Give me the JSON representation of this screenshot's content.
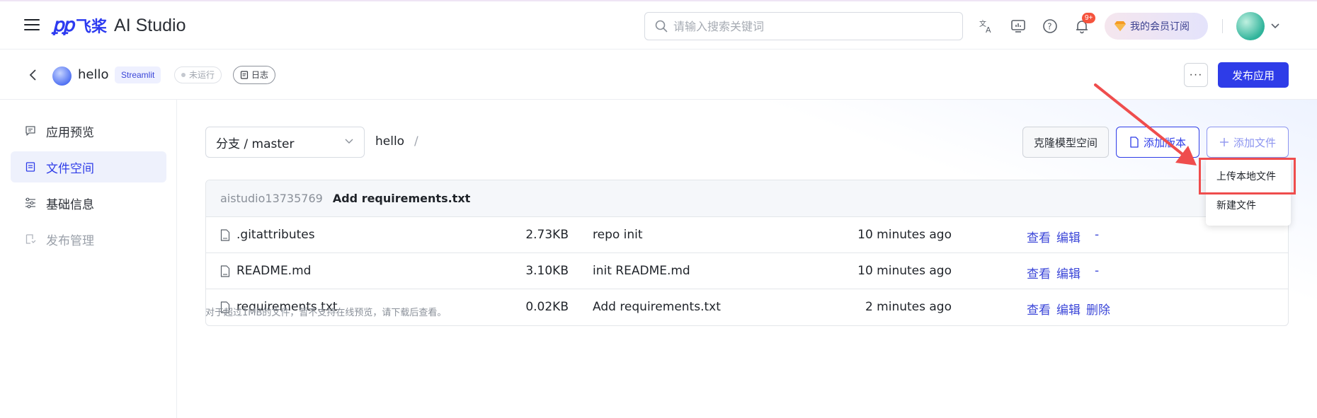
{
  "header": {
    "logo_mark": "ꝑꝑ",
    "logo_cn": "飞桨",
    "logo_en": "AI Studio",
    "search_placeholder": "请输入搜索关键词",
    "notification_badge": "9+",
    "vip_label": "我的会员订阅"
  },
  "project": {
    "name": "hello",
    "framework_tag": "Streamlit",
    "status": "未运行",
    "log_label": "日志",
    "more_label": "···",
    "publish_label": "发布应用"
  },
  "sidebar": {
    "items": [
      {
        "label": "应用预览",
        "icon": "comment-icon",
        "state": "normal"
      },
      {
        "label": "文件空间",
        "icon": "file-icon",
        "state": "active"
      },
      {
        "label": "基础信息",
        "icon": "sliders-icon",
        "state": "normal"
      },
      {
        "label": "发布管理",
        "icon": "publish-doc-icon",
        "state": "disabled"
      }
    ]
  },
  "files": {
    "branch_label": "分支 / master",
    "breadcrumb_root": "hello",
    "breadcrumb_sep": "/",
    "clone_label": "克隆模型空间",
    "add_version_label": "添加版本",
    "add_file_label": "添加文件",
    "latest_commit": {
      "author": "aistudio13735769",
      "message": "Add requirements.txt"
    },
    "rows": [
      {
        "name": ".gitattributes",
        "size": "2.73KB",
        "commit": "repo init",
        "time": "10 minutes ago",
        "view": "查看",
        "edit": "编辑",
        "delete": "-"
      },
      {
        "name": "README.md",
        "size": "3.10KB",
        "commit": "init README.md",
        "time": "10 minutes ago",
        "view": "查看",
        "edit": "编辑",
        "delete": "-"
      },
      {
        "name": "requirements.txt",
        "size": "0.02KB",
        "commit": "Add requirements.txt",
        "time": "2 minutes ago",
        "view": "查看",
        "edit": "编辑",
        "delete": "删除"
      }
    ],
    "note": "对于超过1MB的文件，暂不支持在线预览，请下载后查看。"
  },
  "dropdown": {
    "upload_local": "上传本地文件",
    "new_file": "新建文件"
  },
  "colors": {
    "brand": "#2e3ce8",
    "annotation_red": "#ef4d4d",
    "badge_red": "#f5533d"
  }
}
